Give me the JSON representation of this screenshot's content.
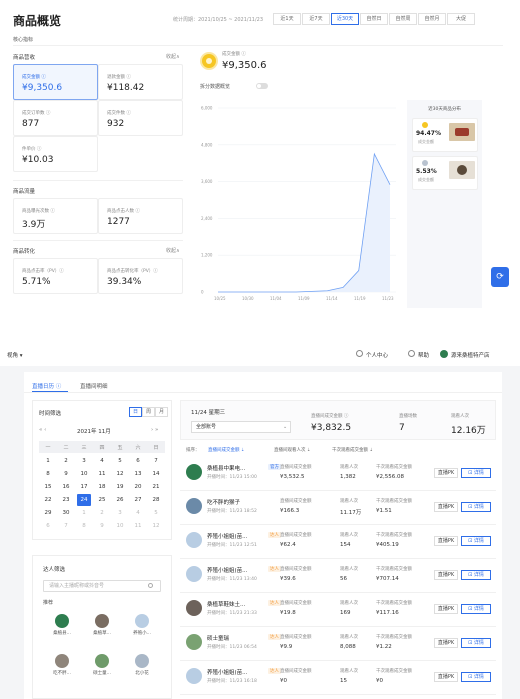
{
  "page1": {
    "title": "商品概览",
    "date_range": "统计周期：2021/10/25 ~ 2021/11/23",
    "periods": [
      "近1天",
      "近7天",
      "近30天",
      "自然日",
      "自然周",
      "自然月",
      "大促"
    ],
    "active_period": "近30天",
    "core_section": "核心指标",
    "groups": {
      "operation": {
        "title": "商品营收",
        "fold": "收起∧"
      },
      "traffic": {
        "title": "商品流量"
      },
      "conversion": {
        "title": "商品转化",
        "fold": "收起∧"
      }
    },
    "metrics": {
      "gmv": {
        "label": "成交金额 ⓘ",
        "value": "¥9,350.6"
      },
      "refund": {
        "label": "退款金额 ⓘ",
        "value": "¥118.42"
      },
      "orders": {
        "label": "成交订单数 ⓘ",
        "value": "877"
      },
      "items": {
        "label": "成交件数 ⓘ",
        "value": "932"
      },
      "unit_price": {
        "label": "件单价 ⓘ",
        "value": "¥10.03"
      },
      "exposure": {
        "label": "商品曝光次数 ⓘ",
        "value": "3.9万"
      },
      "clicks": {
        "label": "商品点击人数 ⓘ",
        "value": "1277"
      },
      "ctr": {
        "label": "商品点击率（PV）ⓘ",
        "value": "5.71%"
      },
      "cvr": {
        "label": "商品点击转化率（PV）ⓘ",
        "value": "39.34%"
      }
    },
    "gmv_summary": {
      "label": "成交金额 ⓘ",
      "value": "¥9,350.6"
    },
    "toggle_label": "拆分数据概览",
    "chart_data": {
      "type": "line",
      "x": [
        "10/25",
        "10/30",
        "11/04",
        "11/09",
        "11/14",
        "11/19",
        "11/23"
      ],
      "yticks": [
        "6,000",
        "4,800",
        "3,600",
        "2,400",
        "1,200",
        "0"
      ],
      "series": [
        {
          "values": [
            0,
            0,
            0,
            0,
            0,
            0,
            20,
            40,
            150,
            700,
            4500,
            3500
          ]
        }
      ],
      "ylim": [
        0,
        6000
      ],
      "xlabel": "",
      "ylabel": ""
    },
    "top_products": {
      "title": "近30天商品分布",
      "items": [
        {
          "pct": "94.47%",
          "sub": "成交金额"
        },
        {
          "pct": "5.53%",
          "sub": "成交金额"
        }
      ]
    },
    "float_icon": "refresh-icon"
  },
  "page2": {
    "topbar": {
      "view": "视角 ▾",
      "personal": "个人中心",
      "help": "帮助",
      "shop": "源来桑植特产店"
    },
    "tabs": [
      "直播日历 ⓘ",
      "直播间明细"
    ],
    "active_tab": "直播日历 ⓘ",
    "time_filter": {
      "title": "时间筛选",
      "modes": [
        "日",
        "周",
        "月"
      ],
      "active_mode": "日",
      "nav_prev": "« ‹",
      "nav_next": "› »",
      "month": "2021年 11月",
      "weekdays": [
        "一",
        "二",
        "三",
        "四",
        "五",
        "六",
        "日"
      ],
      "days": [
        [
          "1",
          "2",
          "3",
          "4",
          "5",
          "6",
          "7"
        ],
        [
          "1",
          "2",
          "3",
          "4",
          "5",
          "6",
          "7"
        ],
        [
          "8",
          "9",
          "10",
          "11",
          "12",
          "13",
          "14"
        ],
        [
          "15",
          "16",
          "17",
          "18",
          "19",
          "20",
          "21"
        ],
        [
          "22",
          "23",
          "24",
          "25",
          "26",
          "27",
          "28"
        ],
        [
          "29",
          "30",
          "1",
          "2",
          "3",
          "4",
          "5"
        ],
        [
          "6",
          "7",
          "8",
          "9",
          "10",
          "11",
          "12"
        ]
      ],
      "selected_day": "24"
    },
    "talent": {
      "title": "达人筛选",
      "placeholder": "请输入主播昵称或抖音号",
      "recommend": "推荐",
      "people": [
        "桑植县...",
        "桑植草...",
        "养殖小...",
        "吃不胖...",
        "硕士童...",
        "北小花"
      ]
    },
    "summary": {
      "date": "11/24 星期三",
      "account": "全部账号",
      "gmv_label": "直播间成交金额 ⓘ",
      "gmv_value": "¥3,832.5",
      "count_label": "直播场数",
      "count_value": "7",
      "views_label": "观看人次",
      "views_value": "12.16万"
    },
    "sort": {
      "label": "排序：",
      "options": [
        "直播间成交金额 ⇣",
        "直播间观看人次 ⇣",
        "千次观看成交金额 ⇣"
      ]
    },
    "col_labels": {
      "gmv": "直播间成交金额",
      "views": "观看人次",
      "per_k": "千次观看成交金额"
    },
    "buttons": {
      "pk": "直播PK",
      "detail": "⊡ 详情"
    },
    "rows": [
      {
        "name": "桑植县中果电...",
        "tag": "官方",
        "tagc": "bl",
        "time": "开播时间：11/23 15:00",
        "gmv": "¥3,532.5",
        "views": "1,382",
        "per_k": "¥2,556.08"
      },
      {
        "name": "吃不胖的猴子",
        "tag": "",
        "tagc": "",
        "time": "开播时间：11/23 18:52",
        "gmv": "¥166.3",
        "views": "11.17万",
        "per_k": "¥1.51"
      },
      {
        "name": "养殖小姐姐(苗...",
        "tag": "达人",
        "tagc": "or",
        "time": "开播时间：11/23 12:51",
        "gmv": "¥62.4",
        "views": "154",
        "per_k": "¥405.19"
      },
      {
        "name": "养殖小姐姐(苗...",
        "tag": "达人",
        "tagc": "or",
        "time": "开播时间：11/23 13:40",
        "gmv": "¥39.6",
        "views": "56",
        "per_k": "¥707.14"
      },
      {
        "name": "桑植草鞋妹土...",
        "tag": "达人",
        "tagc": "or",
        "time": "开播时间：11/23 21:33",
        "gmv": "¥19.8",
        "views": "169",
        "per_k": "¥117.16"
      },
      {
        "name": "硕士童瑞",
        "tag": "达人",
        "tagc": "or",
        "time": "开播时间：11/23 06:54",
        "gmv": "¥9.9",
        "views": "8,088",
        "per_k": "¥1.22"
      },
      {
        "name": "养殖小姐姐(苗...",
        "tag": "达人",
        "tagc": "or",
        "time": "开播时间：11/23 16:18",
        "gmv": "¥0",
        "views": "15",
        "per_k": "¥0"
      }
    ]
  }
}
